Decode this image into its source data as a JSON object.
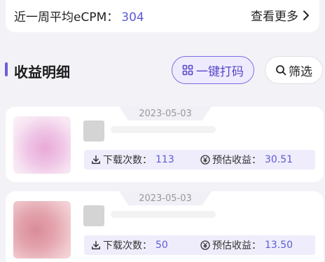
{
  "summary": {
    "ecpm_label": "近一周平均eCPM：",
    "ecpm_value": "304",
    "see_more": "查看更多"
  },
  "section": {
    "title": "收益明细",
    "code_button": "一键打码",
    "filter_button": "筛选"
  },
  "records": [
    {
      "date": "2023-05-03",
      "downloads_label": "下载次数：",
      "downloads": "113",
      "income_label": "预估收益：",
      "income": "30.51"
    },
    {
      "date": "2023-05-03",
      "downloads_label": "下载次数：",
      "downloads": "50",
      "income_label": "预估收益：",
      "income": "13.50"
    }
  ],
  "colors": {
    "accent": "#5b5bd6",
    "accent_bar": "#6b5fd6",
    "stats_bg": "#efedfb"
  },
  "icons": {
    "see_more": "chevron-right-icon",
    "code": "grid-icon",
    "filter": "search-icon",
    "downloads": "download-icon",
    "income": "yen-coin-icon"
  }
}
